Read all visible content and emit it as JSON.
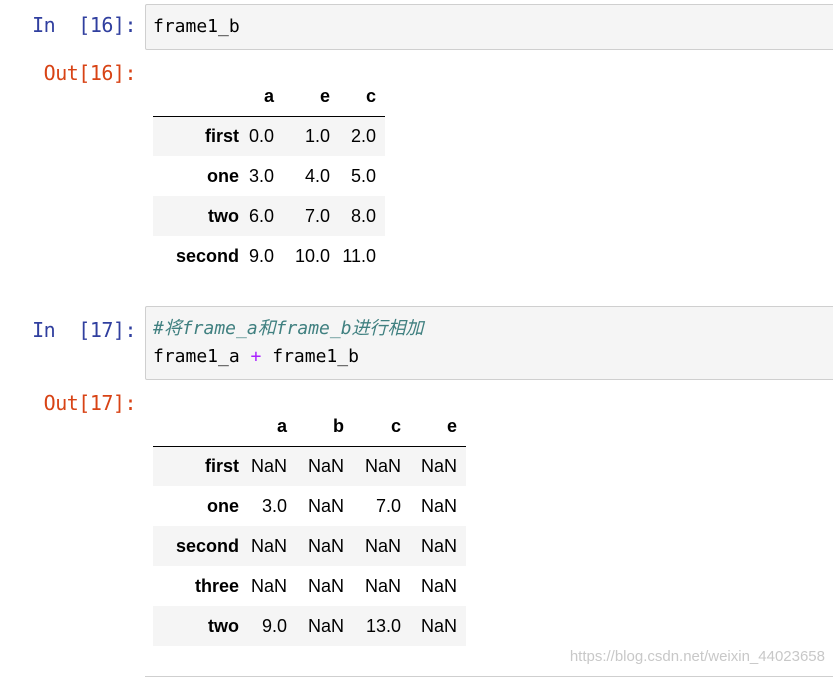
{
  "cell16": {
    "in_prompt": "In  [16]:",
    "code": "frame1_b",
    "out_prompt": "Out[16]:",
    "columns": [
      "a",
      "e",
      "c"
    ],
    "rows": [
      {
        "index": "first",
        "values": [
          "0.0",
          "1.0",
          "2.0"
        ]
      },
      {
        "index": "one",
        "values": [
          "3.0",
          "4.0",
          "5.0"
        ]
      },
      {
        "index": "two",
        "values": [
          "6.0",
          "7.0",
          "8.0"
        ]
      },
      {
        "index": "second",
        "values": [
          "9.0",
          "10.0",
          "11.0"
        ]
      }
    ]
  },
  "cell17": {
    "in_prompt": "In  [17]:",
    "comment": "#将frame_a和frame_b进行相加",
    "code_left": "frame1_a ",
    "code_op": "+",
    "code_right": " frame1_b",
    "out_prompt": "Out[17]:",
    "columns": [
      "a",
      "b",
      "c",
      "e"
    ],
    "rows": [
      {
        "index": "first",
        "values": [
          "NaN",
          "NaN",
          "NaN",
          "NaN"
        ]
      },
      {
        "index": "one",
        "values": [
          "3.0",
          "NaN",
          "7.0",
          "NaN"
        ]
      },
      {
        "index": "second",
        "values": [
          "NaN",
          "NaN",
          "NaN",
          "NaN"
        ]
      },
      {
        "index": "three",
        "values": [
          "NaN",
          "NaN",
          "NaN",
          "NaN"
        ]
      },
      {
        "index": "two",
        "values": [
          "9.0",
          "NaN",
          "13.0",
          "NaN"
        ]
      }
    ]
  },
  "watermark": "https://blog.csdn.net/weixin_44023658"
}
